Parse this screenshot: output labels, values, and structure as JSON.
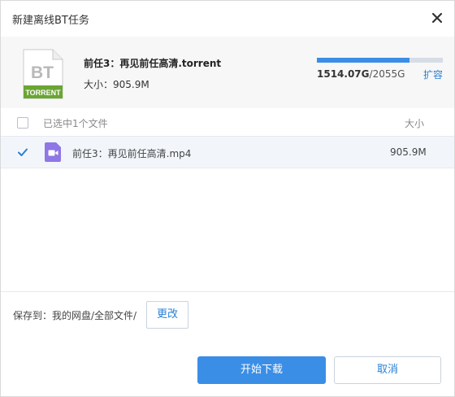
{
  "dialog": {
    "title": "新建离线BT任务"
  },
  "torrent": {
    "icon": {
      "name": "bt-torrent-file-icon",
      "top_text": "BT",
      "bottom_text": "TORRENT"
    },
    "name": "前任3：再见前任高清.torrent",
    "size_text": "大小：905.9M"
  },
  "quota": {
    "used": "1514.07G",
    "separator": "/",
    "total": "2055G",
    "used_fraction": 0.737,
    "expand_label": "扩容"
  },
  "list": {
    "header": {
      "selected_text": "已选中1个文件",
      "size_column": "大小"
    },
    "files": [
      {
        "name": "前任3：再见前任高清.mp4",
        "size": "905.9M",
        "checked": true,
        "icon": "video-icon"
      }
    ]
  },
  "save": {
    "label": "保存到：我的网盘/全部文件/",
    "change_label": "更改"
  },
  "actions": {
    "start_label": "开始下载",
    "cancel_label": "取消"
  },
  "colors": {
    "accent": "#3a8ee6",
    "link": "#2a7fd4",
    "bt_green": "#6ba533",
    "video_purple": "#8f77e6"
  }
}
